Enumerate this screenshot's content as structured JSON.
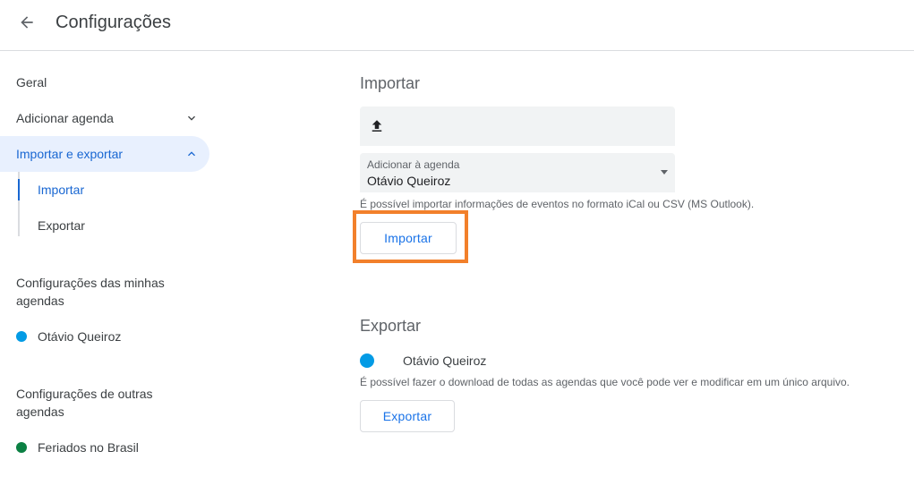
{
  "header": {
    "title": "Configurações",
    "back_icon": "arrow-left-icon"
  },
  "sidebar": {
    "items": [
      {
        "label": "Geral"
      },
      {
        "label": "Adicionar agenda",
        "icon": "chevron-down-icon"
      },
      {
        "label": "Importar e exportar",
        "icon": "chevron-up-icon"
      }
    ],
    "subitems": [
      {
        "label": "Importar"
      },
      {
        "label": "Exportar"
      }
    ],
    "my_calendars": {
      "heading": "Configurações das minhas agendas",
      "items": [
        {
          "label": "Otávio Queiroz",
          "color": "#039be5"
        }
      ]
    },
    "other_calendars": {
      "heading": "Configurações de outras agendas",
      "items": [
        {
          "label": "Feriados no Brasil",
          "color": "#0b8043"
        }
      ]
    }
  },
  "import": {
    "title": "Importar",
    "file_icon": "upload-icon",
    "select": {
      "label": "Adicionar à agenda",
      "value": "Otávio Queiroz"
    },
    "hint": "É possível importar informações de eventos no formato iCal ou CSV (MS Outlook).",
    "button_label": "Importar",
    "highlight_color": "#f2802b"
  },
  "export": {
    "title": "Exportar",
    "calendar": {
      "label": "Otávio Queiroz",
      "color": "#039be5"
    },
    "hint": "É possível fazer o download de todas as agendas que você pode ver e modificar em um único arquivo.",
    "button_label": "Exportar"
  },
  "colors": {
    "accent": "#1a73e8",
    "active_bg": "#e8f0fe"
  }
}
